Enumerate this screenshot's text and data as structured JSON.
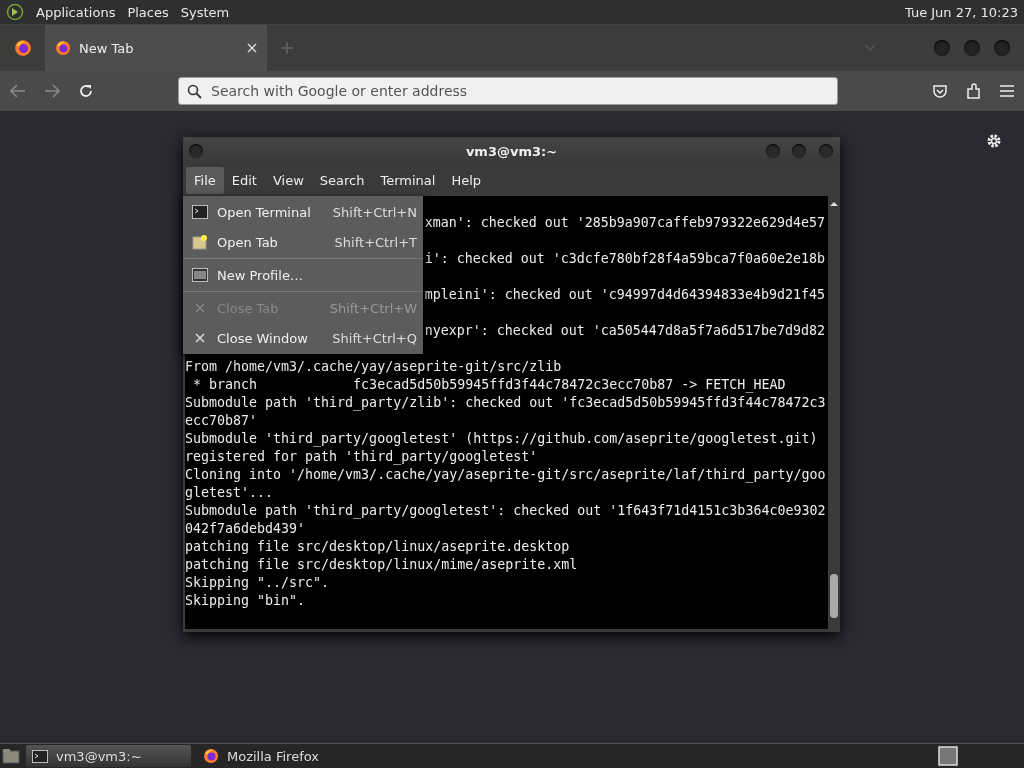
{
  "top_panel": {
    "menus": [
      "Applications",
      "Places",
      "System"
    ],
    "clock": "Tue Jun 27, 10:23"
  },
  "browser": {
    "tabs": [
      {
        "title": "New Tab",
        "selected": true
      }
    ],
    "address": {
      "placeholder": "Search with Google or enter address"
    }
  },
  "terminal": {
    "title": "vm3@vm3:~",
    "menus": [
      {
        "label": "File",
        "selected": true
      },
      {
        "label": "Edit",
        "selected": false
      },
      {
        "label": "View",
        "selected": false
      },
      {
        "label": "Search",
        "selected": false
      },
      {
        "label": "Terminal",
        "selected": false
      },
      {
        "label": "Help",
        "selected": false
      }
    ],
    "file_menu": [
      {
        "items": [
          {
            "kind": "terminal",
            "label": "Open Terminal",
            "shortcut": "Shift+Ctrl+N",
            "disabled": false
          },
          {
            "kind": "tab",
            "label": "Open Tab",
            "shortcut": "Shift+Ctrl+T",
            "disabled": false
          }
        ]
      },
      {
        "items": [
          {
            "kind": "profile",
            "label": "New Profile…",
            "disabled": false
          }
        ]
      },
      {
        "items": [
          {
            "kind": "close",
            "label": "Close Tab",
            "shortcut": "Shift+Ctrl+W",
            "disabled": true
          },
          {
            "kind": "close",
            "label": "Close Window",
            "shortcut": "Shift+Ctrl+Q",
            "disabled": false
          }
        ]
      }
    ],
    "lines": [
      {
        "kind": "partial",
        "text": "xman': checked out '285b9a907caffeb979322e629d4e57"
      },
      {
        "kind": "partial",
        "text": "i': checked out 'c3dcfe780bf28f4a59bca7f0a60e2e18b"
      },
      {
        "kind": "partial",
        "text": "mpleini': checked out 'c94997d4d64394833e4b9d21f45"
      },
      {
        "kind": "partial",
        "text": "nyexpr': checked out 'ca505447d8a5f7a6d517be7d9d82"
      },
      {
        "kind": "full",
        "text": "From /home/vm3/.cache/yay/aseprite-git/src/zlib"
      },
      {
        "kind": "full",
        "text": " * branch            fc3ecad5d50b59945ffd3f44c78472c3ecc70b87 -> FETCH_HEAD"
      },
      {
        "kind": "full",
        "text": "Submodule path 'third_party/zlib': checked out 'fc3ecad5d50b59945ffd3f44c78472c3"
      },
      {
        "kind": "full",
        "text": "ecc70b87'"
      },
      {
        "kind": "full",
        "text": "Submodule 'third_party/googletest' (https://github.com/aseprite/googletest.git)"
      },
      {
        "kind": "full",
        "text": "registered for path 'third_party/googletest'"
      },
      {
        "kind": "full",
        "text": "Cloning into '/home/vm3/.cache/yay/aseprite-git/src/aseprite/laf/third_party/goo"
      },
      {
        "kind": "full",
        "text": "gletest'..."
      },
      {
        "kind": "full",
        "text": "Submodule path 'third_party/googletest': checked out '1f643f71d4151c3b364c0e9302"
      },
      {
        "kind": "full",
        "text": "042f7a6debd439'"
      },
      {
        "kind": "full",
        "text": "patching file src/desktop/linux/aseprite.desktop"
      },
      {
        "kind": "full",
        "text": "patching file src/desktop/linux/mime/aseprite.xml"
      },
      {
        "kind": "full",
        "text": "Skipping \"../src\"."
      },
      {
        "kind": "full",
        "text": "Skipping \"bin\"."
      }
    ]
  },
  "taskbar": {
    "tasks": [
      {
        "kind": "terminal",
        "label": "vm3@vm3:~",
        "selected": true
      },
      {
        "kind": "firefox",
        "label": "Mozilla Firefox",
        "selected": false
      }
    ]
  }
}
